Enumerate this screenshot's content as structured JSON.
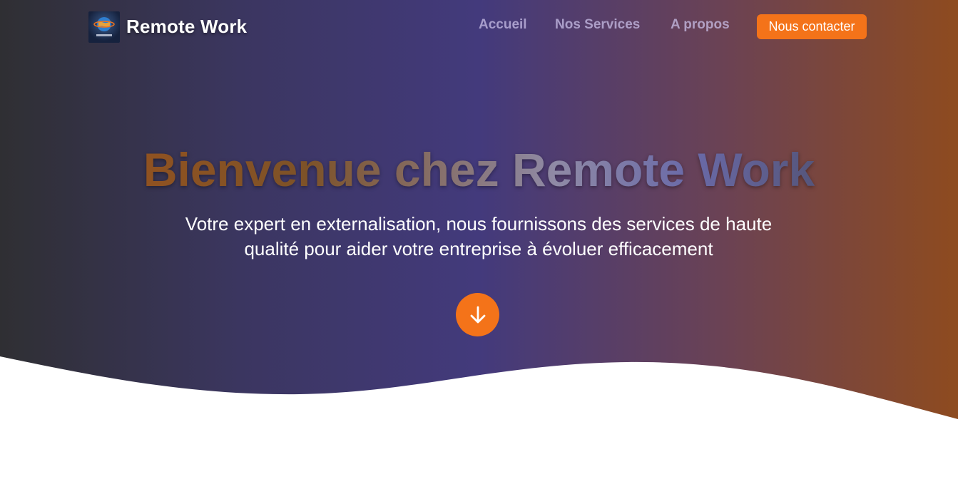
{
  "navbar": {
    "brand": "Remote Work",
    "logo_icon": "globe-logo-icon",
    "links": [
      {
        "label": "Accueil"
      },
      {
        "label": "Nos Services"
      },
      {
        "label": "A propos"
      }
    ],
    "contact_label": "Nous contacter"
  },
  "hero": {
    "title": "Bienvenue chez Remote Work",
    "subtitle": "Votre expert en externalisation, nous fournissons des services de haute qualité pour aider votre entreprise à évoluer efficacement",
    "scroll_icon": "arrow-down-icon"
  },
  "colors": {
    "accent": "#f47319",
    "gradient_start": "#2f2f33",
    "gradient_mid": "#433a7c",
    "gradient_end": "#8e4b1f",
    "background": "#ffffff"
  }
}
